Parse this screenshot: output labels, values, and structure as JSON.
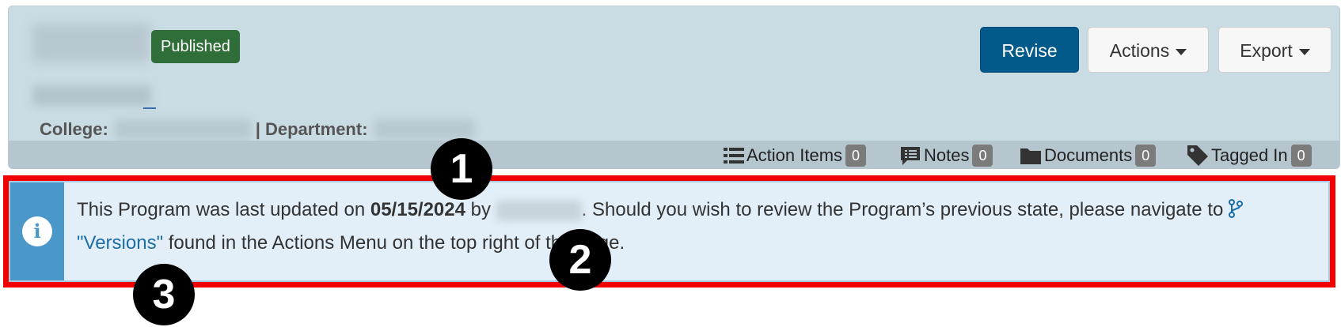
{
  "header": {
    "status_badge": "Published",
    "college_label": "College:",
    "separator": "|",
    "department_label": "Department:",
    "buttons": {
      "revise": "Revise",
      "actions": "Actions",
      "export": "Export"
    },
    "tabs": [
      {
        "label": "Action Items",
        "count": "0",
        "icon": "list-icon"
      },
      {
        "label": "Notes",
        "count": "0",
        "icon": "comment-icon"
      },
      {
        "label": "Documents",
        "count": "0",
        "icon": "folder-icon"
      },
      {
        "label": "Tagged In",
        "count": "0",
        "icon": "tag-icon"
      }
    ]
  },
  "alert": {
    "text_before": "This Program was last updated on ",
    "date": "05/15/2024",
    "text_by": " by ",
    "text_after": ". Should you wish to review the Program’s previous state, please navigate to ",
    "versions_label": "\"Versions\"",
    "text_end": " found in the Actions Menu on the top right of the page.",
    "icon": "info-icon"
  },
  "annotations": {
    "marker_1": "1",
    "marker_2": "2",
    "marker_3": "3",
    "highlight_color": "#f20000"
  },
  "colors": {
    "published": "#2f6e39",
    "revise": "#015a8a",
    "info": "#4a97ca"
  }
}
